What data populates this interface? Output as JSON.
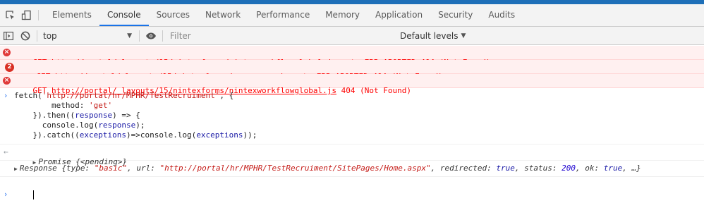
{
  "tabs": [
    "Elements",
    "Console",
    "Sources",
    "Network",
    "Performance",
    "Memory",
    "Application",
    "Security",
    "Audits"
  ],
  "active_tab": "Console",
  "toolbar": {
    "context_value": "top",
    "filter_placeholder": "Filter",
    "levels_label": "Default levels"
  },
  "errors": [
    {
      "method": "GET",
      "url": "http://portal/_layouts/15/nintexforms/nintexworkflowglobal.js",
      "status": "net::ERR_ABORTED 404 (Not Found)",
      "badge": ""
    },
    {
      "method": "GET",
      "url": "http://portal/_layouts/15/nintexforms/resources.js",
      "status": "net::ERR_ABORTED 404 (Not Found)",
      "badge": "2"
    },
    {
      "method": "GET",
      "url": "http://portal/_layouts/15/nintexforms/nintexworkflowglobal.js",
      "status": "404 (Not Found)",
      "badge": ""
    }
  ],
  "code": {
    "fn": "fetch(",
    "url": "'http://portal/hr/MPHR/TestRecruiment'",
    "open": ", {",
    "method_key": "method: ",
    "method_val": "'get'",
    "then_open": "}).then((",
    "response": "response",
    "then_arrow": ") => {",
    "log_call": "console.log(",
    "log_arg": "response",
    "log_close": ");",
    "catch_open": "}).catch((",
    "exceptions": "exceptions",
    "catch_mid": ")=>console.log(",
    "exceptions2": "exceptions",
    "catch_close": "));"
  },
  "promise_result": "Promise {<pending>}",
  "response_result": {
    "prefix": "Response {type: ",
    "type": "\"basic\"",
    "url_key": ", url: ",
    "url": "\"http://portal/hr/MPHR/TestRecruiment/SitePages/Home.aspx\"",
    "redirected_key": ", redirected: ",
    "redirected": "true",
    "status_key": ", status: ",
    "status": "200",
    "ok_key": ", ok: ",
    "ok": "true",
    "suffix": ", …}"
  }
}
